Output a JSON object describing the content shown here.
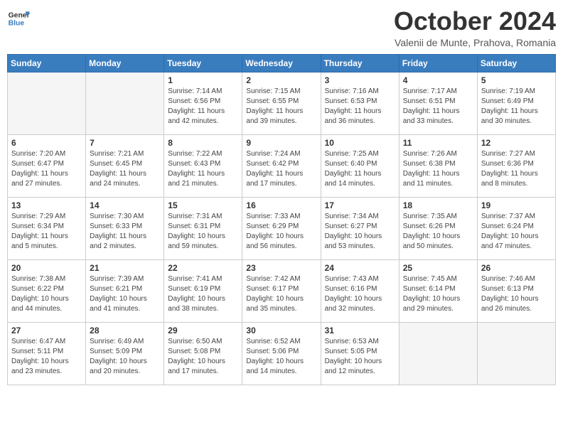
{
  "header": {
    "logo_line1": "General",
    "logo_line2": "Blue",
    "month": "October 2024",
    "location": "Valenii de Munte, Prahova, Romania"
  },
  "weekdays": [
    "Sunday",
    "Monday",
    "Tuesday",
    "Wednesday",
    "Thursday",
    "Friday",
    "Saturday"
  ],
  "weeks": [
    [
      {
        "day": "",
        "info": ""
      },
      {
        "day": "",
        "info": ""
      },
      {
        "day": "1",
        "info": "Sunrise: 7:14 AM\nSunset: 6:56 PM\nDaylight: 11 hours and 42 minutes."
      },
      {
        "day": "2",
        "info": "Sunrise: 7:15 AM\nSunset: 6:55 PM\nDaylight: 11 hours and 39 minutes."
      },
      {
        "day": "3",
        "info": "Sunrise: 7:16 AM\nSunset: 6:53 PM\nDaylight: 11 hours and 36 minutes."
      },
      {
        "day": "4",
        "info": "Sunrise: 7:17 AM\nSunset: 6:51 PM\nDaylight: 11 hours and 33 minutes."
      },
      {
        "day": "5",
        "info": "Sunrise: 7:19 AM\nSunset: 6:49 PM\nDaylight: 11 hours and 30 minutes."
      }
    ],
    [
      {
        "day": "6",
        "info": "Sunrise: 7:20 AM\nSunset: 6:47 PM\nDaylight: 11 hours and 27 minutes."
      },
      {
        "day": "7",
        "info": "Sunrise: 7:21 AM\nSunset: 6:45 PM\nDaylight: 11 hours and 24 minutes."
      },
      {
        "day": "8",
        "info": "Sunrise: 7:22 AM\nSunset: 6:43 PM\nDaylight: 11 hours and 21 minutes."
      },
      {
        "day": "9",
        "info": "Sunrise: 7:24 AM\nSunset: 6:42 PM\nDaylight: 11 hours and 17 minutes."
      },
      {
        "day": "10",
        "info": "Sunrise: 7:25 AM\nSunset: 6:40 PM\nDaylight: 11 hours and 14 minutes."
      },
      {
        "day": "11",
        "info": "Sunrise: 7:26 AM\nSunset: 6:38 PM\nDaylight: 11 hours and 11 minutes."
      },
      {
        "day": "12",
        "info": "Sunrise: 7:27 AM\nSunset: 6:36 PM\nDaylight: 11 hours and 8 minutes."
      }
    ],
    [
      {
        "day": "13",
        "info": "Sunrise: 7:29 AM\nSunset: 6:34 PM\nDaylight: 11 hours and 5 minutes."
      },
      {
        "day": "14",
        "info": "Sunrise: 7:30 AM\nSunset: 6:33 PM\nDaylight: 11 hours and 2 minutes."
      },
      {
        "day": "15",
        "info": "Sunrise: 7:31 AM\nSunset: 6:31 PM\nDaylight: 10 hours and 59 minutes."
      },
      {
        "day": "16",
        "info": "Sunrise: 7:33 AM\nSunset: 6:29 PM\nDaylight: 10 hours and 56 minutes."
      },
      {
        "day": "17",
        "info": "Sunrise: 7:34 AM\nSunset: 6:27 PM\nDaylight: 10 hours and 53 minutes."
      },
      {
        "day": "18",
        "info": "Sunrise: 7:35 AM\nSunset: 6:26 PM\nDaylight: 10 hours and 50 minutes."
      },
      {
        "day": "19",
        "info": "Sunrise: 7:37 AM\nSunset: 6:24 PM\nDaylight: 10 hours and 47 minutes."
      }
    ],
    [
      {
        "day": "20",
        "info": "Sunrise: 7:38 AM\nSunset: 6:22 PM\nDaylight: 10 hours and 44 minutes."
      },
      {
        "day": "21",
        "info": "Sunrise: 7:39 AM\nSunset: 6:21 PM\nDaylight: 10 hours and 41 minutes."
      },
      {
        "day": "22",
        "info": "Sunrise: 7:41 AM\nSunset: 6:19 PM\nDaylight: 10 hours and 38 minutes."
      },
      {
        "day": "23",
        "info": "Sunrise: 7:42 AM\nSunset: 6:17 PM\nDaylight: 10 hours and 35 minutes."
      },
      {
        "day": "24",
        "info": "Sunrise: 7:43 AM\nSunset: 6:16 PM\nDaylight: 10 hours and 32 minutes."
      },
      {
        "day": "25",
        "info": "Sunrise: 7:45 AM\nSunset: 6:14 PM\nDaylight: 10 hours and 29 minutes."
      },
      {
        "day": "26",
        "info": "Sunrise: 7:46 AM\nSunset: 6:13 PM\nDaylight: 10 hours and 26 minutes."
      }
    ],
    [
      {
        "day": "27",
        "info": "Sunrise: 6:47 AM\nSunset: 5:11 PM\nDaylight: 10 hours and 23 minutes."
      },
      {
        "day": "28",
        "info": "Sunrise: 6:49 AM\nSunset: 5:09 PM\nDaylight: 10 hours and 20 minutes."
      },
      {
        "day": "29",
        "info": "Sunrise: 6:50 AM\nSunset: 5:08 PM\nDaylight: 10 hours and 17 minutes."
      },
      {
        "day": "30",
        "info": "Sunrise: 6:52 AM\nSunset: 5:06 PM\nDaylight: 10 hours and 14 minutes."
      },
      {
        "day": "31",
        "info": "Sunrise: 6:53 AM\nSunset: 5:05 PM\nDaylight: 10 hours and 12 minutes."
      },
      {
        "day": "",
        "info": ""
      },
      {
        "day": "",
        "info": ""
      }
    ]
  ]
}
